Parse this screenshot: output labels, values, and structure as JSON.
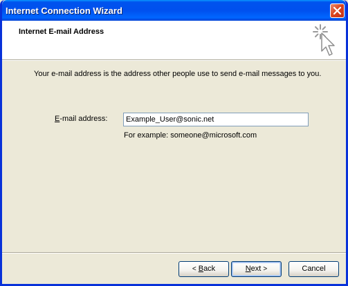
{
  "window": {
    "title": "Internet Connection Wizard"
  },
  "header": {
    "title": "Internet E-mail Address"
  },
  "main": {
    "intro_text": "Your e-mail address is the address other people use to send e-mail messages to you.",
    "email_label_mnemonic": "E",
    "email_label_rest": "-mail address:",
    "email_value": "Example_User@sonic.net",
    "example_text": "For example: someone@microsoft.com"
  },
  "buttons": {
    "back_mnemonic": "B",
    "back_rest": "ack",
    "back_arrow": "<",
    "next_mnemonic": "N",
    "next_rest": "ext",
    "next_arrow": ">",
    "cancel_label": "Cancel"
  },
  "icons": {
    "close": "close-icon",
    "wizard": "wizard-sparkle-cursor-icon"
  },
  "colors": {
    "title_bar": "#0053ee",
    "close_button": "#d9431c",
    "dialog_background": "#ece9d8",
    "header_background": "#ffffff"
  }
}
